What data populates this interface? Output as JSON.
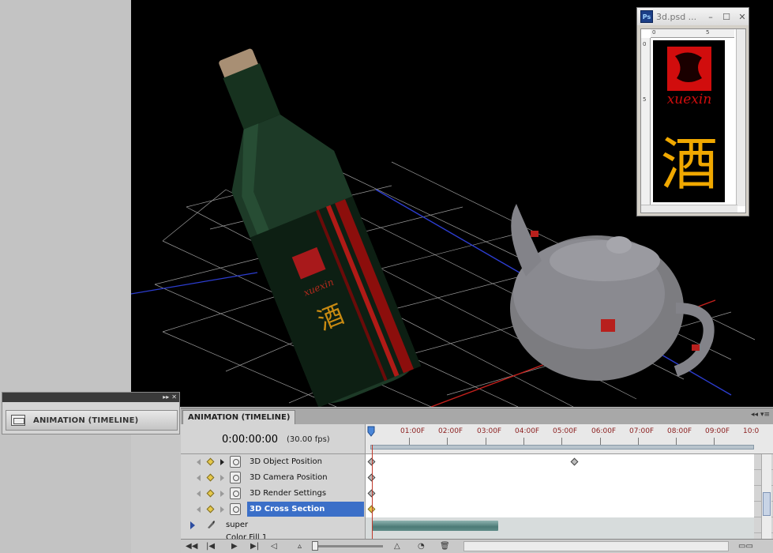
{
  "document_window": {
    "app_badge": "Ps",
    "title": "3d.psd ...",
    "ruler_top_marks": [
      "0",
      "5"
    ],
    "ruler_left_marks": [
      "0",
      "5"
    ],
    "artwork_brand_text": "xuexin",
    "artwork_character": "酒"
  },
  "dock_panel": {
    "button_label": "ANIMATION (TIMELINE)"
  },
  "timeline": {
    "tab_label": "ANIMATION (TIMELINE)",
    "current_time": "0:00:00:00",
    "fps": "(30.00 fps)",
    "ruler_labels": [
      "01:00F",
      "02:00F",
      "03:00F",
      "04:00F",
      "05:00F",
      "06:00F",
      "07:00F",
      "08:00F",
      "09:00F",
      "10:0"
    ],
    "property_rows": [
      {
        "label": "3D Object Position",
        "selected": false
      },
      {
        "label": "3D Camera Position",
        "selected": false
      },
      {
        "label": "3D Render Settings",
        "selected": false
      },
      {
        "label": "3D Cross Section",
        "selected": true
      }
    ],
    "layers": [
      {
        "name": "super"
      },
      {
        "name": "Color Fill 1"
      }
    ]
  },
  "viewport": {
    "bottle_label_text": "xuexin",
    "bottle_character": "酒"
  },
  "colors": {
    "selection": "#3b6fc8",
    "ruler_label": "#8a1d1d",
    "playhead": "#c0392b",
    "keyframe_selected": "#e6c84a",
    "bottle_green": "#1f3d2a",
    "artwork_red": "#d10d0d",
    "artwork_yellow": "#f0a800"
  }
}
